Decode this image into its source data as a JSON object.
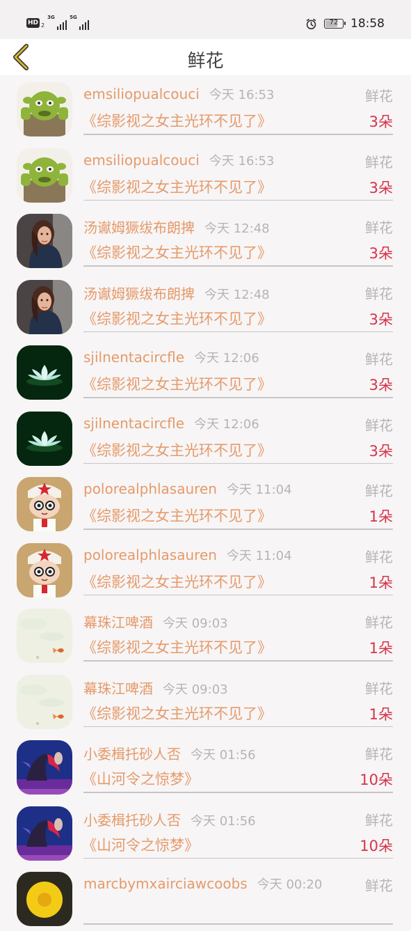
{
  "status_bar": {
    "network_badge": "HD",
    "network_sub": "2",
    "signal_1_tag": "3G",
    "signal_2_tag": "5G",
    "battery_level": 72,
    "battery_label": "72",
    "clock": "18:58"
  },
  "nav": {
    "title": "鲜花"
  },
  "list": [
    {
      "username": "emsiliopualcouci",
      "time": "今天 16:53",
      "type": "鲜花",
      "book": "《综影视之女主光环不见了》",
      "count": "3朵",
      "avatar": "shrek-avatar"
    },
    {
      "username": "emsiliopualcouci",
      "time": "今天 16:53",
      "type": "鲜花",
      "book": "《综影视之女主光环不见了》",
      "count": "3朵",
      "avatar": "shrek-avatar"
    },
    {
      "username": "汤谳姆獗绂布朗捭",
      "time": "今天 12:48",
      "type": "鲜花",
      "book": "《综影视之女主光环不见了》",
      "count": "3朵",
      "avatar": "woman-portrait-avatar"
    },
    {
      "username": "汤谳姆獗绂布朗捭",
      "time": "今天 12:48",
      "type": "鲜花",
      "book": "《综影视之女主光环不见了》",
      "count": "3朵",
      "avatar": "woman-portrait-avatar"
    },
    {
      "username": "sjilnentacircfle",
      "time": "今天 12:06",
      "type": "鲜花",
      "book": "《综影视之女主光环不见了》",
      "count": "3朵",
      "avatar": "lotus-avatar"
    },
    {
      "username": "sjilnentacircfle",
      "time": "今天 12:06",
      "type": "鲜花",
      "book": "《综影视之女主光环不见了》",
      "count": "3朵",
      "avatar": "lotus-avatar"
    },
    {
      "username": "polorealphlasauren",
      "time": "今天 11:04",
      "type": "鲜花",
      "book": "《综影视之女主光环不见了》",
      "count": "1朵",
      "avatar": "cartoon-nurse-avatar"
    },
    {
      "username": "polorealphlasauren",
      "time": "今天 11:04",
      "type": "鲜花",
      "book": "《综影视之女主光环不见了》",
      "count": "1朵",
      "avatar": "cartoon-nurse-avatar"
    },
    {
      "username": "幕珠江啤酒",
      "time": "今天 09:03",
      "type": "鲜花",
      "book": "《综影视之女主光环不见了》",
      "count": "1朵",
      "avatar": "goldfish-painting-avatar"
    },
    {
      "username": "幕珠江啤酒",
      "time": "今天 09:03",
      "type": "鲜花",
      "book": "《综影视之女主光环不见了》",
      "count": "1朵",
      "avatar": "goldfish-painting-avatar"
    },
    {
      "username": "小委楫托砂人否",
      "time": "今天 01:56",
      "type": "鲜花",
      "book": "《山河令之惊梦》",
      "count": "10朵",
      "avatar": "game-character-avatar"
    },
    {
      "username": "小委楫托砂人否",
      "time": "今天 01:56",
      "type": "鲜花",
      "book": "《山河令之惊梦》",
      "count": "10朵",
      "avatar": "game-character-avatar"
    },
    {
      "username": "marcbymxairciawcoobs",
      "time": "今天 00:20",
      "type": "鲜花",
      "book": "",
      "count": "",
      "avatar": "yellow-flower-avatar"
    }
  ],
  "colors": {
    "username": "#e59a6a",
    "book_title": "#e59a6a",
    "count": "#d6334a",
    "muted": "#b9b3b3",
    "back_arrow": "#d9b72a"
  }
}
